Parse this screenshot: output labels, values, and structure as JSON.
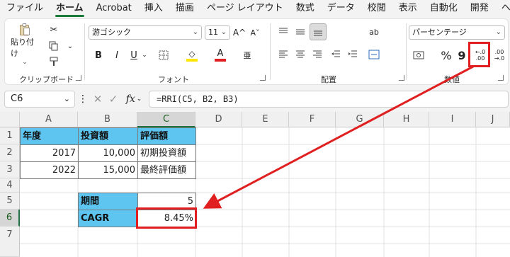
{
  "menu": {
    "tabs": [
      "ファイル",
      "ホーム",
      "Acrobat",
      "挿入",
      "描画",
      "ページ レイアウト",
      "数式",
      "データ",
      "校閲",
      "表示",
      "自動化",
      "開発",
      "ヘルプ"
    ],
    "active_tab": "ホーム"
  },
  "ribbon": {
    "clipboard": {
      "paste_label": "貼り付け",
      "group_label": "クリップボード"
    },
    "font": {
      "font_name": "游ゴシック",
      "font_size": "11",
      "bold": "B",
      "italic": "I",
      "underline": "U",
      "group_label": "フォント",
      "grow": "A^",
      "shrink": "Aˇ",
      "font_color_glyph": "A",
      "phonetic": "亜"
    },
    "alignment": {
      "group_label": "配置",
      "wrap": "ab"
    },
    "number": {
      "format_value": "パーセンテージ",
      "percent": "%",
      "comma": "9",
      "group_label": "数値",
      "inc_decimal": "←.0 .00",
      "dec_decimal": ".00 →.0"
    }
  },
  "formula_bar": {
    "name_box": "C6",
    "fx": "fx",
    "formula": "=RRI(C5, B2, B3)"
  },
  "sheet": {
    "columns": [
      "A",
      "B",
      "C",
      "D",
      "E",
      "F",
      "G",
      "H",
      "I",
      "J"
    ],
    "rows": [
      "1",
      "2",
      "3",
      "4",
      "5",
      "6",
      "7"
    ],
    "selected_cell": "C6",
    "cells": {
      "A1": "年度",
      "B1": "投資額",
      "C1": "評価額",
      "A2": "2017",
      "B2": "10,000",
      "C2": "初期投資額",
      "A3": "2022",
      "B3": "15,000",
      "C3": "最終評価額",
      "B5": "期間",
      "C5": "5",
      "B6": "CAGR",
      "C6": "8.45%"
    }
  },
  "colors": {
    "header_fill": "#5ec5f0",
    "annotation": "#e02020",
    "excel_green": "#217346"
  }
}
